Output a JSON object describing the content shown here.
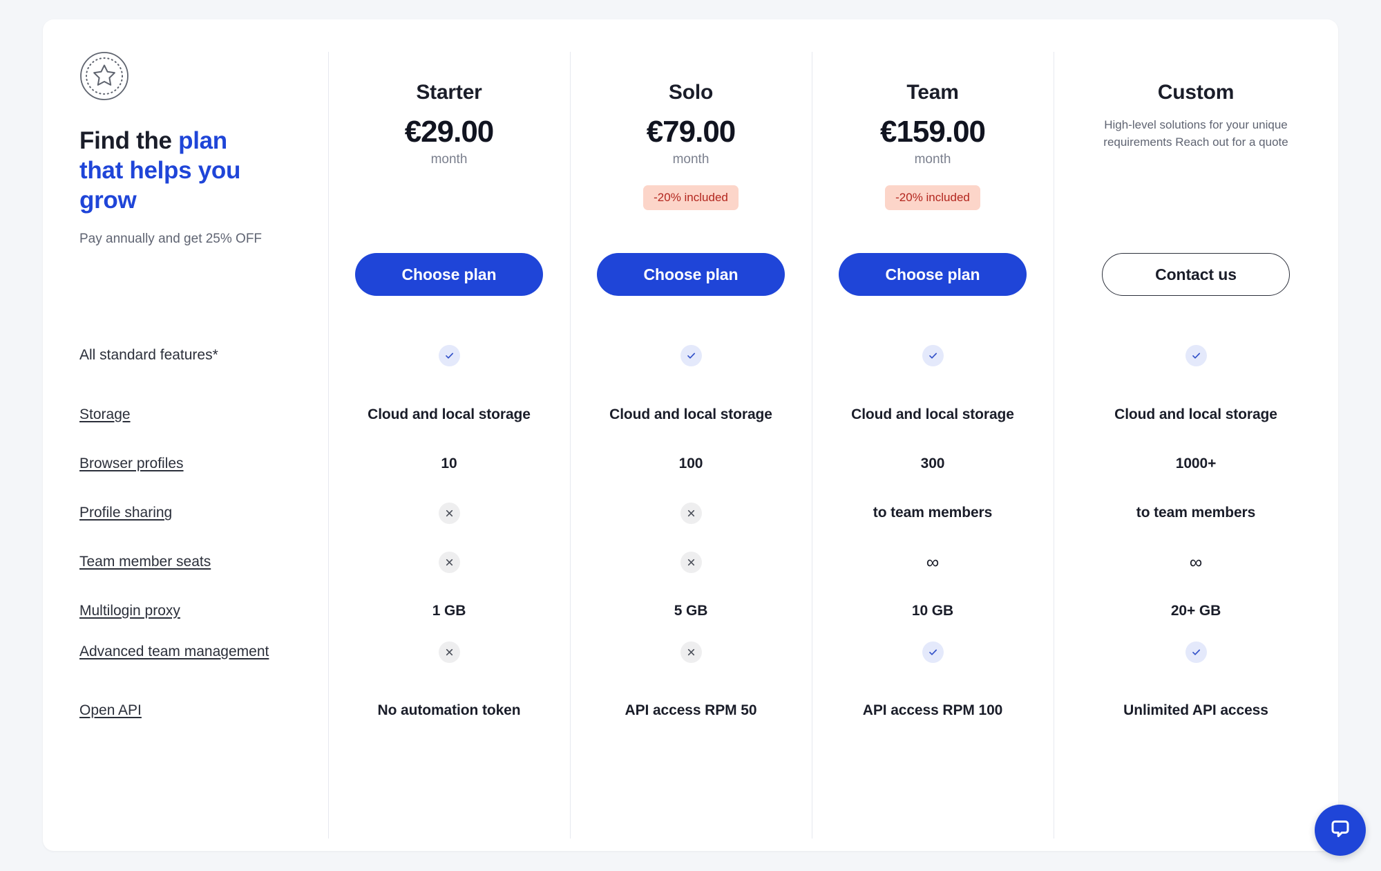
{
  "intro": {
    "badge_icon": "star-badge-icon",
    "title_part1": "Find the ",
    "title_highlight": "plan that helps you grow",
    "subtitle": "Pay annually and get 25% OFF"
  },
  "plans": [
    {
      "name": "Starter",
      "price": "€29.00",
      "period": "month",
      "description": "",
      "discount": "",
      "cta": "Choose plan",
      "cta_style": "primary"
    },
    {
      "name": "Solo",
      "price": "€79.00",
      "period": "month",
      "description": "",
      "discount": "-20% included",
      "cta": "Choose plan",
      "cta_style": "primary"
    },
    {
      "name": "Team",
      "price": "€159.00",
      "period": "month",
      "description": "",
      "discount": "-20% included",
      "cta": "Choose plan",
      "cta_style": "primary"
    },
    {
      "name": "Custom",
      "price": "",
      "period": "",
      "description": "High-level solutions for your unique requirements Reach out for a quote",
      "discount": "",
      "cta": "Contact us",
      "cta_style": "outline"
    }
  ],
  "features": [
    {
      "label": "All standard features*",
      "is_link": false,
      "values": [
        "check",
        "check",
        "check",
        "check"
      ]
    },
    {
      "label": "Storage",
      "is_link": true,
      "values": [
        "Cloud and local storage",
        "Cloud and local storage",
        "Cloud and local storage",
        "Cloud and local storage"
      ]
    },
    {
      "label": "Browser profiles",
      "is_link": true,
      "values": [
        "10",
        "100",
        "300",
        "1000+"
      ]
    },
    {
      "label": "Profile sharing",
      "is_link": true,
      "values": [
        "cross",
        "cross",
        "to team members",
        "to team members"
      ]
    },
    {
      "label": "Team member seats",
      "is_link": true,
      "values": [
        "cross",
        "cross",
        "∞",
        "∞"
      ]
    },
    {
      "label": "Multilogin proxy",
      "is_link": true,
      "values": [
        "1 GB",
        "5 GB",
        "10 GB",
        "20+ GB"
      ]
    },
    {
      "label": "Advanced team management",
      "is_link": true,
      "values": [
        "cross",
        "cross",
        "check",
        "check"
      ]
    },
    {
      "label": "Open API",
      "is_link": true,
      "values": [
        "No automation token",
        "API access RPM 50",
        "API access RPM 100",
        "Unlimited API access"
      ]
    }
  ],
  "chat": {
    "icon": "chat-bubble-icon"
  },
  "colors": {
    "accent": "#1f45d8",
    "text": "#1a1d29",
    "muted": "#5f6472",
    "badge_bg": "#fcd5c9",
    "badge_text": "#b3261e",
    "check_bg": "#e4e9fb",
    "cross_bg": "#eeeeef",
    "page_bg": "#f4f6f9"
  }
}
